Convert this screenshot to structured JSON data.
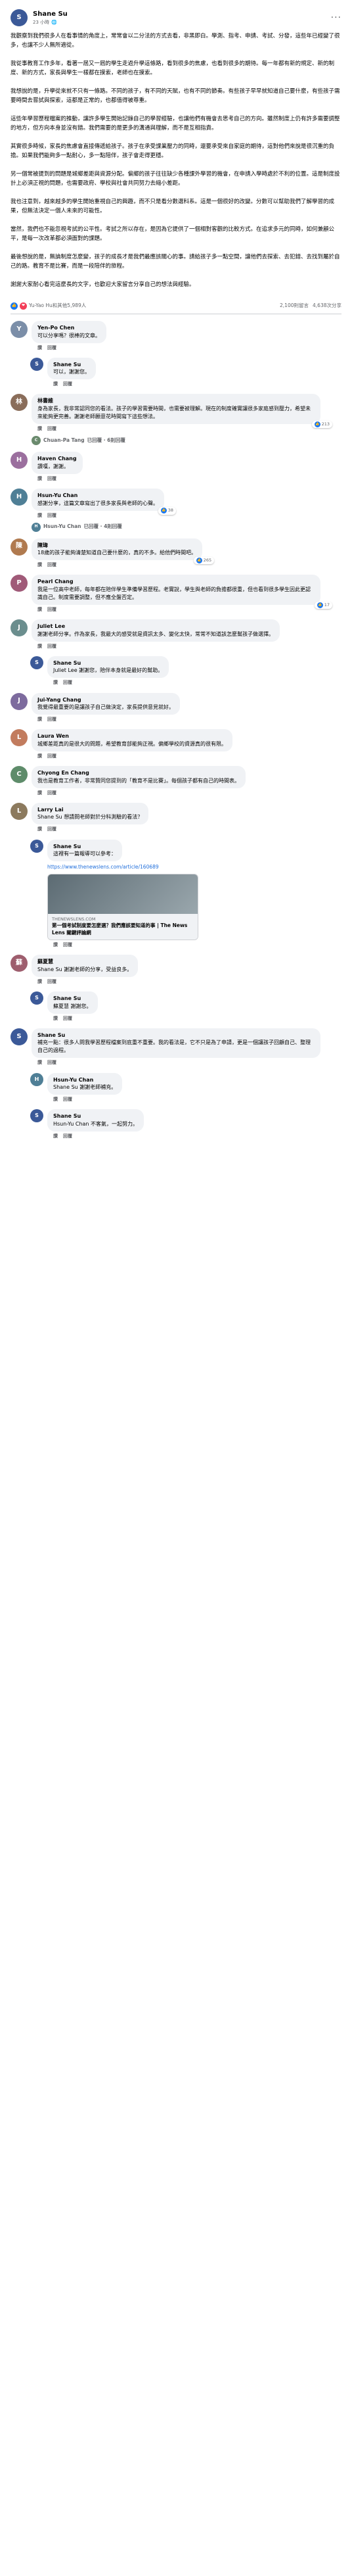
{
  "post": {
    "author": "Shane Su",
    "time": "23 小時",
    "paragraphs": [
      "我觀察到我們很多人在看事情的角度上，常常會以二分法的方式去看，非黑即白。學測、指考、申請、考試、分發，這些年已經變了很多，也讓不少人無所適從。",
      "我從事教育工作多年，看著一屆又一屆的學生走過升學這條路，看到很多的焦慮，也看到很多的期待。每一年都有新的規定、新的制度、新的方式，家長與學生一樣都在摸索，老師也在摸索。",
      "我想說的是，升學從來就不只有一條路。不同的孩子，有不同的天賦，也有不同的節奏。有些孩子早早就知道自己要什麼，有些孩子需要時間去嘗試與探索，這都是正常的，也都值得被尊重。",
      "這些年學習歷程檔案的推動，讓許多學生開始記錄自己的學習經驗，也讓他們有機會去思考自己的方向。雖然制度上仍有許多需要調整的地方，但方向本身並沒有錯。我們需要的是更多的溝通與理解，而不是互相指責。",
      "其實很多時候，家長的焦慮會直接傳遞給孩子。孩子在承受課業壓力的同時，還要承受來自家庭的期待，這對他們來說是很沉重的負擔。如果我們能夠多一點耐心，多一點陪伴，孩子會走得更穩。",
      "另一個常被提到的問題是城鄉差距與資源分配。偏鄉的孩子往往缺少各種課外學習的機會，在申請入學時處於不利的位置。這是制度設計上必須正視的問題，也需要政府、學校與社會共同努力去縮小差距。",
      "我也注意到，越來越多的學生開始重視自己的興趣，而不只是看分數選科系。這是一個很好的改變。分數可以幫助我們了解學習的成果，但無法決定一個人未來的可能性。",
      "當然，我們也不能忽視考試的公平性。考試之所以存在，是因為它提供了一個相對客觀的比較方式。在追求多元的同時，如何兼顧公平，是每一次改革都必須面對的課題。",
      "最後想說的是，無論制度怎麼變，孩子的成長才是我們最應該關心的事。請給孩子多一點空間，讓他們去探索、去犯錯、去找到屬於自己的路。教育不是比賽，而是一段陪伴的旅程。",
      "謝謝大家耐心看完這麼長的文字，也歡迎大家留言分享自己的想法與經驗。"
    ],
    "reactions_summary": "Yu-Yao Hu和其他5,989人",
    "comments_count": "2,100則留言",
    "shares_count": "4,638次分享"
  },
  "comments": [
    {
      "name": "Yen-Po Chen",
      "text": "可以分享嗎？很棒的文章。",
      "reply": false,
      "color": "#7b8ea8"
    },
    {
      "name": "Shane Su",
      "text": "可以，謝謝您。",
      "reply": true,
      "color": "#3b5998"
    },
    {
      "name": "林書維",
      "text": "身為家長，我非常認同您的看法。孩子的學習需要時間，也需要被理解。現在的制度確實讓很多家庭感到壓力，希望未來能夠更完善。謝謝老師願意花時間寫下這些想法。",
      "reply": false,
      "color": "#8a6d5a",
      "react": "213"
    },
    {
      "name": "Chuan-Pa Tang",
      "text": "回覆中…",
      "reply": false,
      "replies": "已回覆 · 6則回覆",
      "hide": true,
      "color": "#6a8a6d"
    },
    {
      "name": "Haven Chang",
      "text": "讚嘆，謝謝。",
      "reply": false,
      "color": "#9b6f9e"
    },
    {
      "name": "Hsun-Yu Chan",
      "text": "感謝分享，這篇文章寫出了很多家長與老師的心聲。",
      "reply": false,
      "color": "#4f7f96",
      "react": "38"
    },
    {
      "name": "Hsun-Yu Chan",
      "text": "回覆中…",
      "reply": false,
      "replies": "已回覆 · 4則回覆",
      "hide": true,
      "color": "#4f7f96"
    },
    {
      "name": "陳瑋",
      "text": "18歲的孩子能夠清楚知道自己要什麼的，真的不多。給他們時間吧。",
      "reply": false,
      "color": "#b07a4f",
      "react": "265"
    },
    {
      "name": "Pearl Chang",
      "text": "我是一位高中老師，每年都在陪伴學生準備學習歷程。老實說，學生與老師的負擔都很重，但也看到很多學生因此更認識自己。制度需要調整，但不應全盤否定。",
      "reply": false,
      "color": "#a05a78",
      "react": "17"
    },
    {
      "name": "Juliet Lee",
      "text": "謝謝老師分享。作為家長，我最大的感受就是資訊太多、變化太快，常常不知道該怎麼幫孩子做選擇。",
      "reply": false,
      "color": "#6b8e8e"
    },
    {
      "name": "Shane Su",
      "text": "Juliet Lee 謝謝您，陪伴本身就是最好的幫助。",
      "reply": true,
      "color": "#3b5998"
    },
    {
      "name": "Jui-Yang Chang",
      "text": "我覺得最重要的是讓孩子自己做決定，家長提供意見就好。",
      "reply": false,
      "color": "#7d6b9e"
    },
    {
      "name": "Laura Wen",
      "text": "城鄉差距真的是很大的問題，希望教育部能夠正視。偏鄉學校的資源真的很有限。",
      "reply": false,
      "color": "#c27c5e"
    },
    {
      "name": "Chyong En Chang",
      "text": "我也是教育工作者，非常贊同您提到的「教育不是比賽」。每個孩子都有自己的時間表。",
      "reply": false,
      "color": "#5e8c6a"
    },
    {
      "name": "Larry Lai",
      "text": "Shane Su 想請問老師對於分科測驗的看法？",
      "reply": false,
      "color": "#8c7a5e"
    },
    {
      "name": "Shane Su",
      "text": "這裡有一篇報導可以參考：",
      "reply": true,
      "color": "#3b5998",
      "link": true
    },
    {
      "name": "蘇夏慧",
      "text": "Shane Su 謝謝老師的分享，受益良多。",
      "reply": false,
      "color": "#9e5e6e"
    },
    {
      "name": "Shane Su",
      "text": "蘇夏慧 謝謝您。",
      "reply": true,
      "color": "#3b5998"
    },
    {
      "name": "Shane Su",
      "text": "補充一點：很多人問我學習歷程檔案到底重不重要。我的看法是，它不只是為了申請，更是一個讓孩子回顧自己、整理自己的過程。",
      "reply": false,
      "color": "#3b5998"
    },
    {
      "name": "Hsun-Yu Chan",
      "text": "Shane Su 謝謝老師補充。",
      "reply": true,
      "color": "#4f7f96"
    },
    {
      "name": "Shane Su",
      "text": "Hsun-Yu Chan 不客氣，一起努力。",
      "reply": true,
      "color": "#3b5998"
    }
  ],
  "link_card": {
    "url": "https://www.thenewslens.com/article/160689",
    "domain": "THENEWSLENS.COM",
    "title": "第一個考試制度要怎麼選？我們應該要知道的事 | The News Lens 關鍵評論網"
  },
  "ui": {
    "like": "讚",
    "reply": "回覆",
    "more": "···"
  }
}
